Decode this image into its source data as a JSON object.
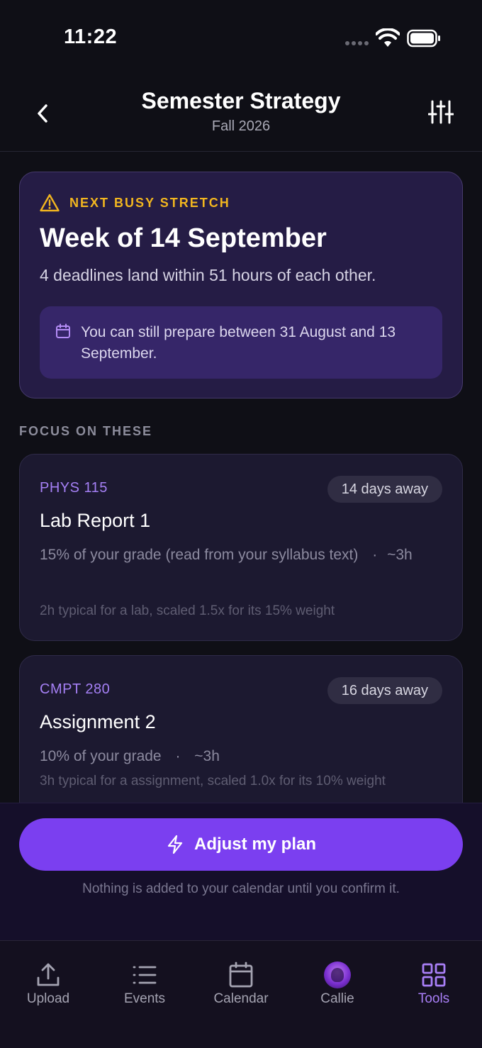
{
  "status_bar": {
    "time": "11:22"
  },
  "header": {
    "title": "Semester Strategy",
    "subtitle": "Fall 2026"
  },
  "busy_stretch": {
    "label": "NEXT BUSY STRETCH",
    "title": "Week of 14 September",
    "description": "4 deadlines land within 51 hours of each other.",
    "prep_text": "You can still prepare between 31 August and 13 September.",
    "accent_color": "#f2b61f"
  },
  "focus": {
    "section_label": "FOCUS ON THESE",
    "cards": [
      {
        "course": "PHYS 115",
        "days_away": "14 days away",
        "title": "Lab Report 1",
        "grade_info": "15% of your grade (read from your syllabus text)",
        "separator": "·",
        "estimate": "~3h",
        "note": "2h typical for a lab, scaled 1.5x for its 15% weight"
      },
      {
        "course": "CMPT 280",
        "days_away": "16 days away",
        "title": "Assignment 2",
        "grade_info": "10% of your grade",
        "separator": "·",
        "estimate": "~3h",
        "note": "3h typical for a assignment, scaled 1.0x for its 10% weight"
      }
    ]
  },
  "action": {
    "button_label": "Adjust my plan",
    "button_icon": "lightning-icon",
    "confirm_note": "Nothing is added to your calendar until you confirm it.",
    "accent_color": "#7b3ff0"
  },
  "tab_bar": {
    "tabs": [
      {
        "label": "Upload",
        "icon": "upload-icon"
      },
      {
        "label": "Events",
        "icon": "list-icon"
      },
      {
        "label": "Calendar",
        "icon": "calendar-icon"
      },
      {
        "label": "Callie",
        "icon": "avatar"
      },
      {
        "label": "Tools",
        "icon": "grid-icon"
      }
    ],
    "active": "Tools",
    "active_color": "#a97ff7"
  }
}
